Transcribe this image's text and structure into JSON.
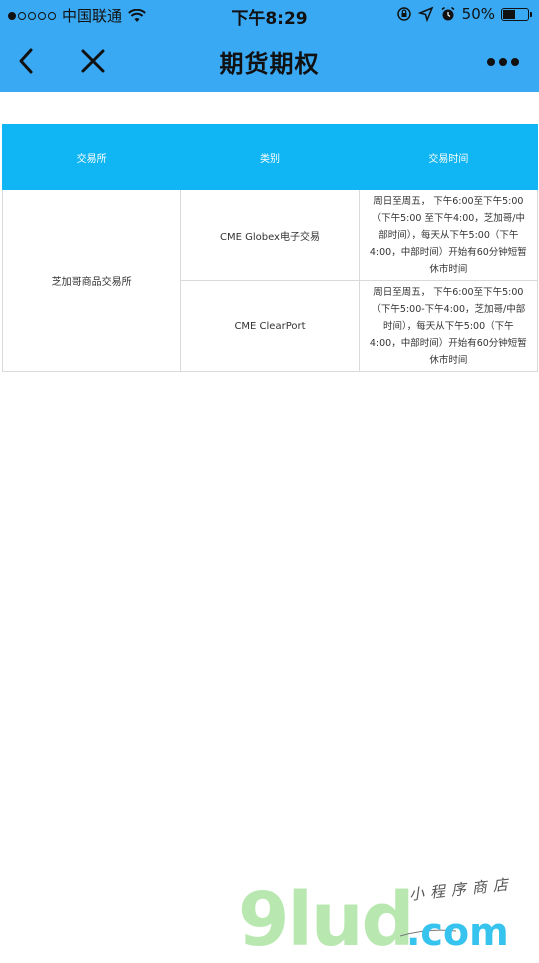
{
  "status_bar": {
    "carrier": "中国联通",
    "time": "下午8:29",
    "battery_percent": "50%",
    "battery_level": 0.5,
    "signal_bars": 1
  },
  "nav": {
    "title": "期货期权",
    "back_icon": "chevron-left-icon",
    "close_icon": "close-icon",
    "more_icon": "more-dots-icon"
  },
  "table": {
    "headers": [
      "交易所",
      "类别",
      "交易时间"
    ],
    "exchange": "芝加哥商品交易所",
    "rows": [
      {
        "category": "CME Globex电子交易",
        "hours": "周日至周五， 下午6:00至下午5:00 （下午5:00 至下午4:00，芝加哥/中部时间），每天从下午5:00（下午4:00，中部时间）开始有60分钟短暂休市时间"
      },
      {
        "category": "CME ClearPort",
        "hours": "周日至周五， 下午6:00至下午5:00 （下午5:00-下午4:00，芝加哥/中部时间），每天从下午5:00（下午4:00，中部时间）开始有60分钟短暂休市时间"
      }
    ]
  },
  "watermark": {
    "brand": "9lud",
    "tld": ".com",
    "tagline": "小程序商店"
  },
  "colors": {
    "header_blue": "#3aa9f4",
    "table_header": "#10b5f3",
    "border": "#d9d9d9"
  }
}
